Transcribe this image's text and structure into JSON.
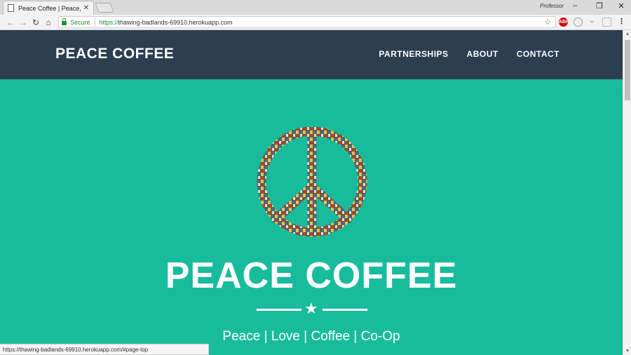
{
  "browser": {
    "tab_title": "Peace Coffee | Peace, Lov",
    "tab_close": "✕",
    "profile": "Professor",
    "omnibox": {
      "security_label": "Secure",
      "url_scheme": "https://",
      "url_rest": "thawing-badlands-69910.herokuapp.com"
    },
    "status_url": "https://thawing-badlands-69910.herokuapp.com/#page-top"
  },
  "navbar": {
    "brand": "PEACE COFFEE",
    "links": [
      "PARTNERSHIPS",
      "ABOUT",
      "CONTACT"
    ]
  },
  "hero": {
    "title": "PEACE COFFEE",
    "tagline": "Peace | Love | Coffee | Co-Op",
    "image": "peace-sign-mosaic"
  },
  "colors": {
    "navbar_bg": "#2c3e50",
    "hero_bg": "#18bc9c",
    "text": "#ffffff"
  }
}
